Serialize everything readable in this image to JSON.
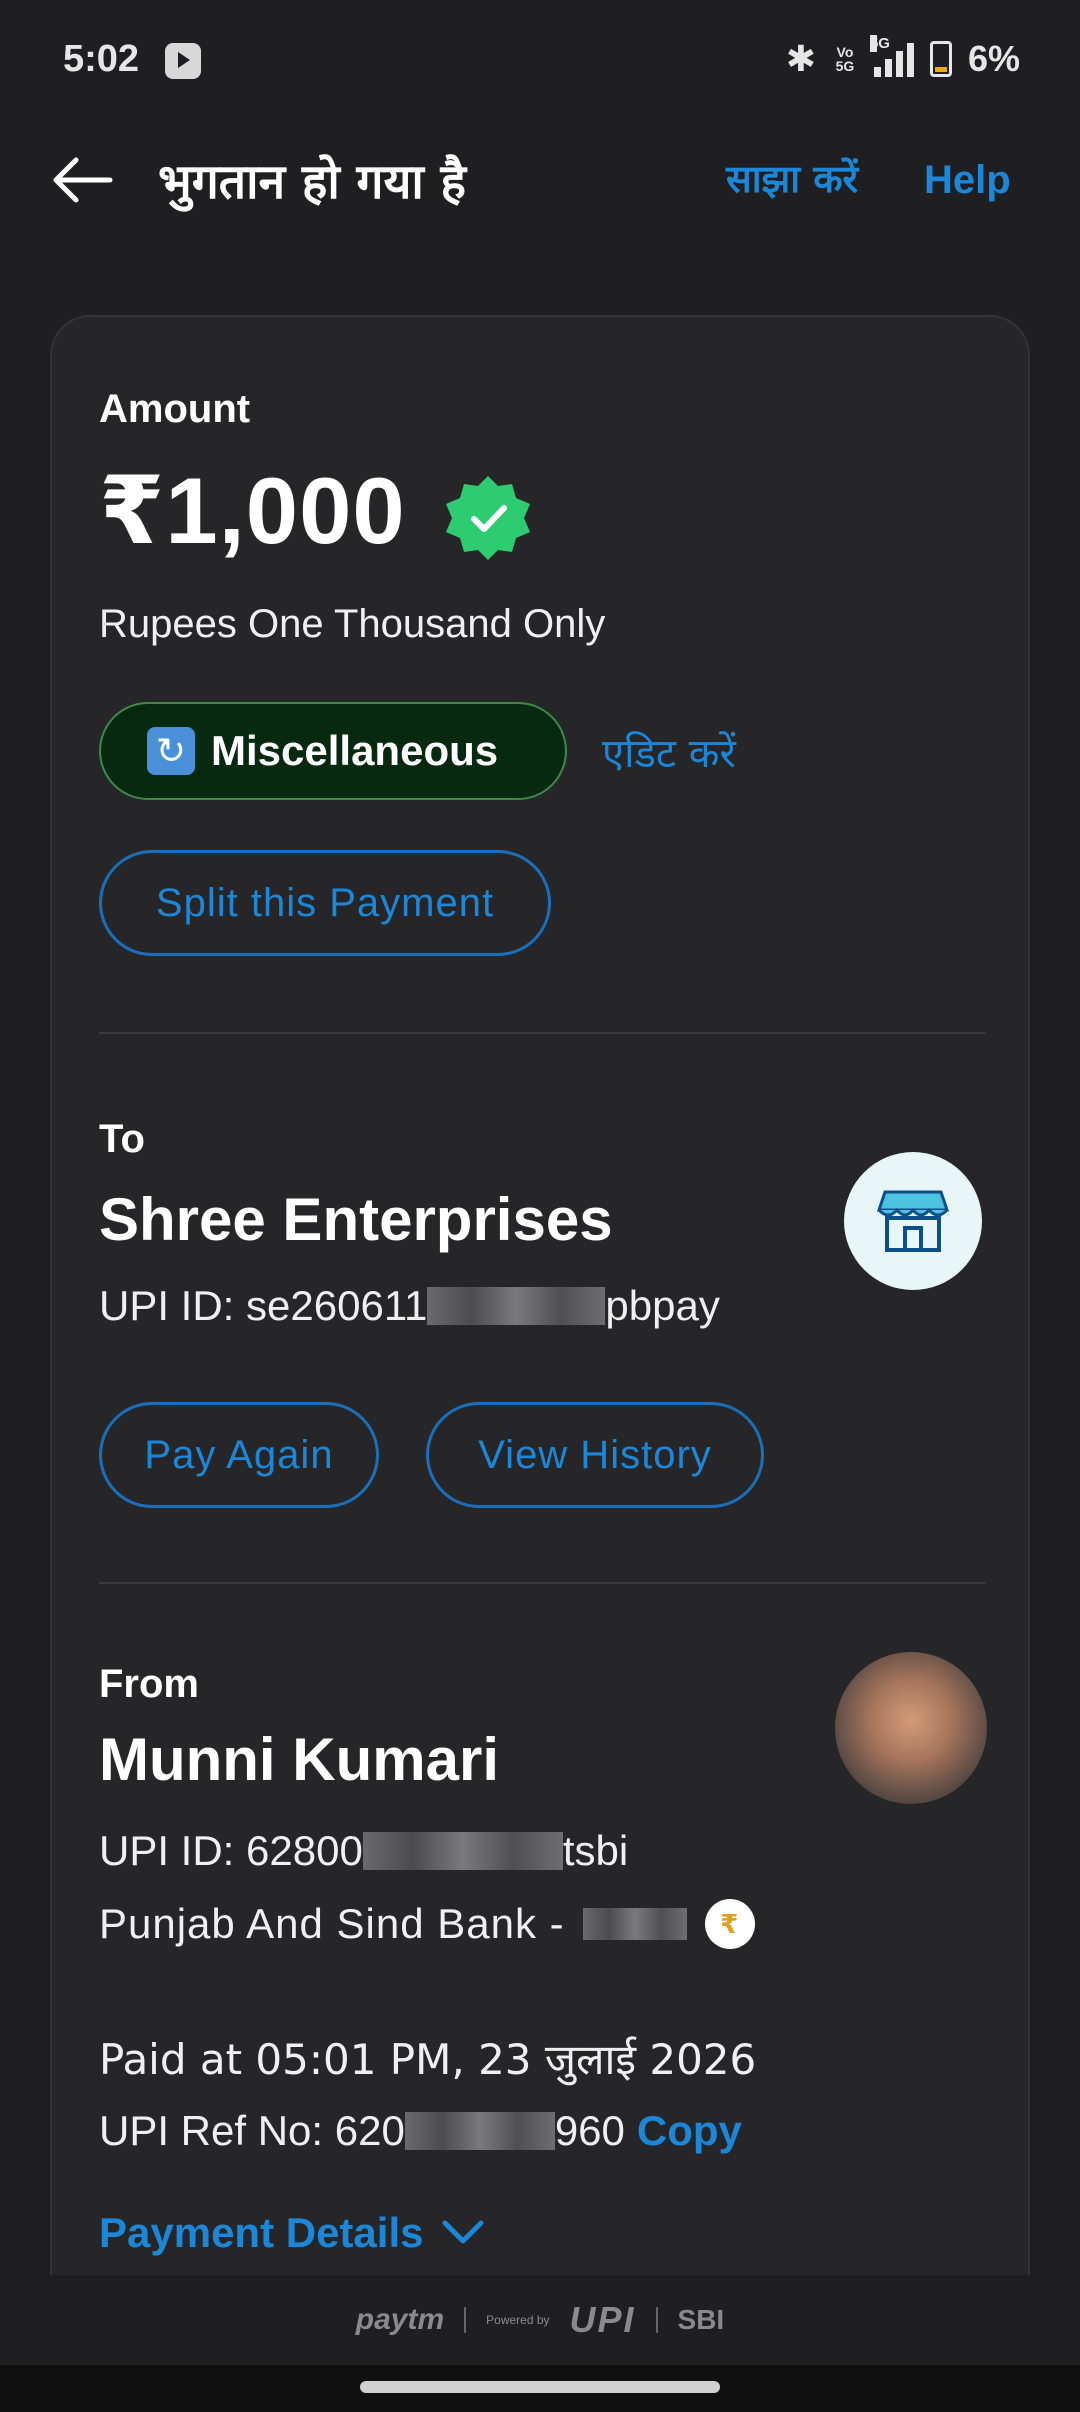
{
  "status_bar": {
    "time": "5:02",
    "battery": "6%",
    "network": "5G",
    "volte": "Vo 5G"
  },
  "header": {
    "title": "भुगतान हो गया है",
    "share_label": "साझा करें",
    "help_label": "Help"
  },
  "amount": {
    "label": "Amount",
    "value": "₹1,000",
    "in_words": "Rupees One Thousand Only",
    "category": "Miscellaneous",
    "edit_label": "एडिट करें",
    "split_label": "Split this Payment"
  },
  "to": {
    "label": "To",
    "name": "Shree Enterprises",
    "upi_prefix": "UPI ID: se260611",
    "upi_suffix": "pbpay",
    "pay_again_label": "Pay Again",
    "history_label": "View History"
  },
  "from": {
    "label": "From",
    "name": "Munni Kumari",
    "upi_prefix": "UPI ID: 62800",
    "upi_suffix": "tsbi",
    "bank": "Punjab And Sind Bank -",
    "paid_at": "Paid at 05:01 PM, 23 जुलाई 2026",
    "ref_prefix": "UPI Ref No: 620",
    "ref_suffix": "960",
    "copy_label": "Copy",
    "details_label": "Payment Details"
  },
  "footer": {
    "paytm": "paytm",
    "powered": "Powered by",
    "upi": "UPI",
    "sbi": "SBI"
  },
  "colors": {
    "accent": "#1a87d9",
    "success": "#2ecc71",
    "background": "#1f1f21",
    "card": "#262628"
  },
  "icons": [
    "back-arrow-icon",
    "verified-check-icon",
    "category-swap-icon",
    "store-icon",
    "bank-icon",
    "chevron-down-icon"
  ]
}
